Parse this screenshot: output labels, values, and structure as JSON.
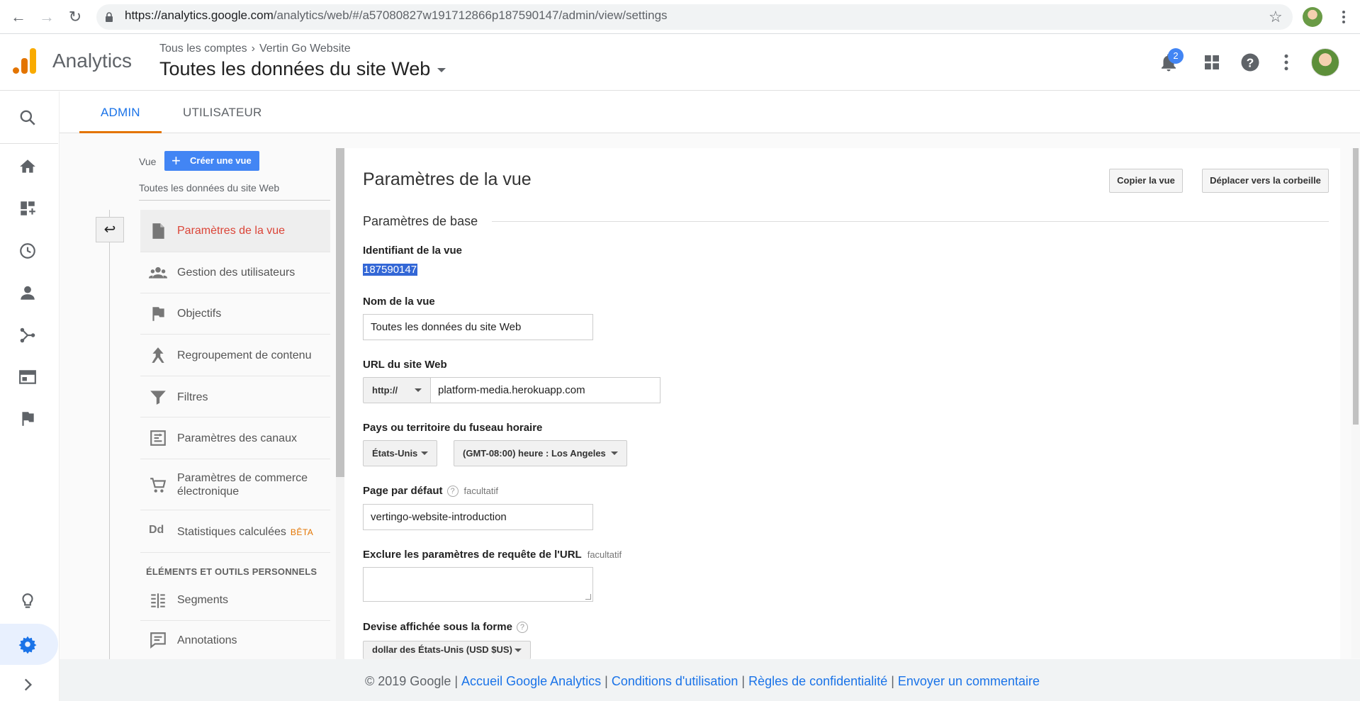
{
  "browser": {
    "url_host": "https://analytics.google.com",
    "url_path": "/analytics/web/#/a57080827w191712866p187590147/admin/view/settings"
  },
  "header": {
    "app_name": "Analytics",
    "breadcrumb_account": "Tous les comptes",
    "breadcrumb_property": "Vertin Go Website",
    "property_view": "Toutes les données du site Web",
    "notification_count": "2"
  },
  "tabs": {
    "admin": "ADMIN",
    "user": "UTILISATEUR"
  },
  "view_column": {
    "label": "Vue",
    "create_button": "Créer une vue",
    "current_view": "Toutes les données du site Web",
    "items": [
      {
        "label": "Paramètres de la vue",
        "icon": "document-icon"
      },
      {
        "label": "Gestion des utilisateurs",
        "icon": "people-icon"
      },
      {
        "label": "Objectifs",
        "icon": "flag-icon"
      },
      {
        "label": "Regroupement de contenu",
        "icon": "content-grouping-icon"
      },
      {
        "label": "Filtres",
        "icon": "filter-icon"
      },
      {
        "label": "Paramètres des canaux",
        "icon": "channel-settings-icon"
      },
      {
        "label": "Paramètres de commerce électronique",
        "icon": "cart-icon"
      },
      {
        "label": "Statistiques calculées",
        "badge": "BÊTA",
        "icon": "calculated-metrics-icon"
      }
    ],
    "personal_section": "ÉLÉMENTS ET OUTILS PERSONNELS",
    "personal_items": [
      {
        "label": "Segments",
        "icon": "segments-icon"
      },
      {
        "label": "Annotations",
        "icon": "annotations-icon"
      }
    ]
  },
  "settings": {
    "title": "Paramètres de la vue",
    "copy_button": "Copier la vue",
    "trash_button": "Déplacer vers la corbeille",
    "basic_section": "Paramètres de base",
    "view_id_label": "Identifiant de la vue",
    "view_id": "187590147",
    "view_name_label": "Nom de la vue",
    "view_name": "Toutes les données du site Web",
    "site_url_label": "URL du site Web",
    "protocol": "http://",
    "site_url": "platform-media.herokuapp.com",
    "timezone_label": "Pays ou territoire du fuseau horaire",
    "country": "États-Unis",
    "timezone": "(GMT-08:00) heure : Los Angeles",
    "default_page_label": "Page par défaut",
    "optional": "facultatif",
    "default_page": "vertingo-website-introduction",
    "exclude_params_label": "Exclure les paramètres de requête de l'URL",
    "exclude_params": "",
    "currency_label": "Devise affichée sous la forme",
    "currency": "dollar des États-Unis (USD $US)"
  },
  "footer": {
    "copyright": "© 2019 Google",
    "links": [
      "Accueil Google Analytics",
      "Conditions d'utilisation",
      "Règles de confidentialité",
      "Envoyer un commentaire"
    ]
  },
  "colors": {
    "accent_blue": "#1a73e8",
    "ga_orange": "#e37400",
    "active_red": "#db4437",
    "button_blue": "#4285f4"
  }
}
